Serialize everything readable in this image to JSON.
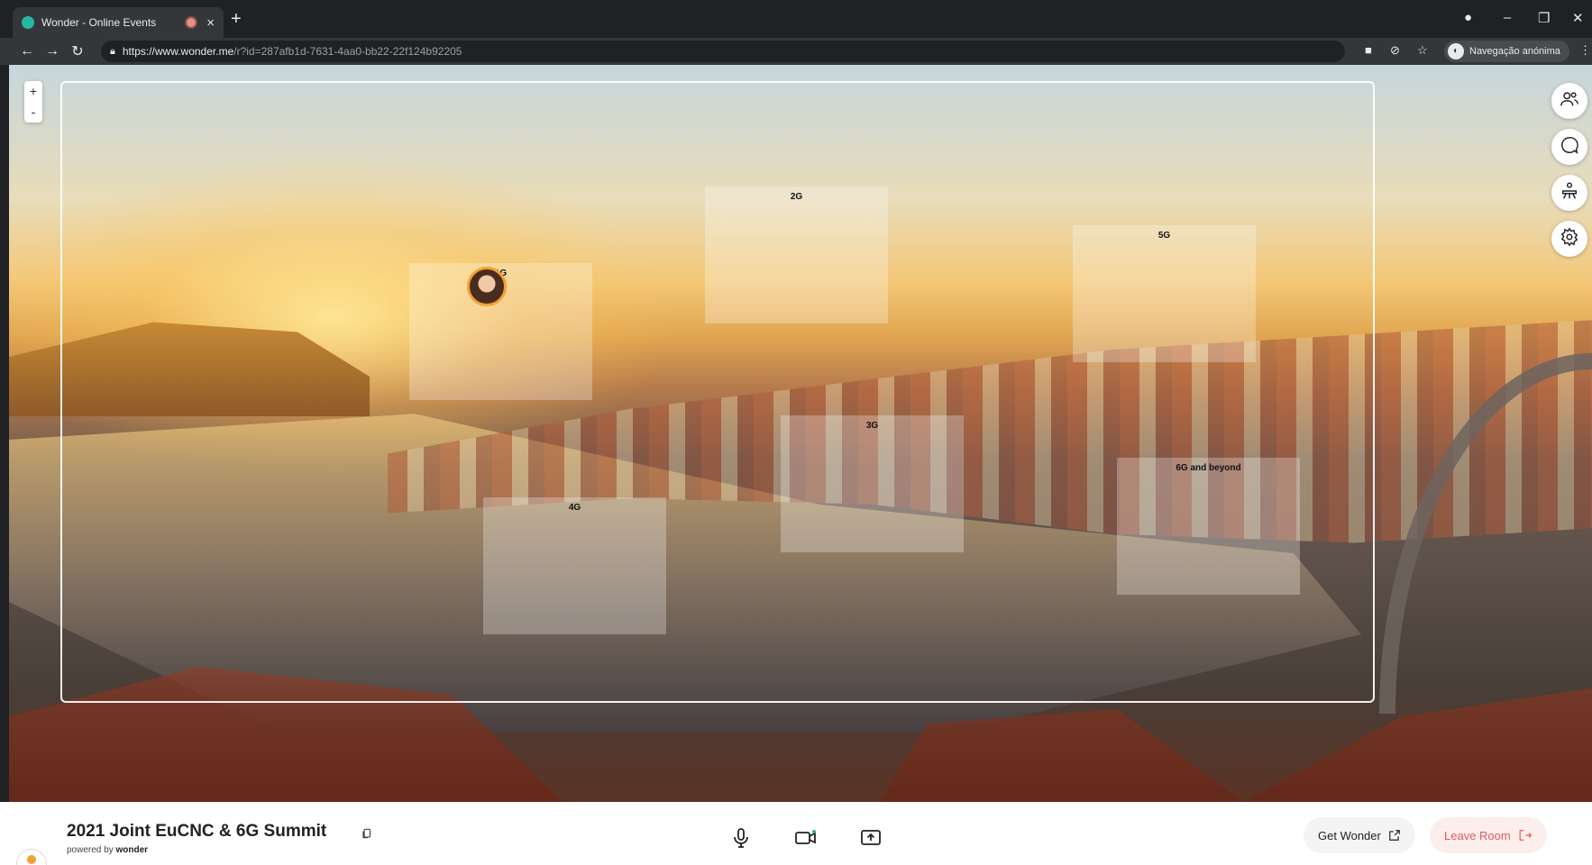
{
  "browser": {
    "tab_title": "Wonder - Online Events",
    "tab_close": "×",
    "new_tab": "+",
    "url_host": "https://www.wonder.me",
    "url_path": "/r?id=287afb1d-7631-4aa0-bb22-22f124b92205",
    "incognito_label": "Navegação anónima",
    "nav_icons": [
      "back-arrow-icon",
      "forward-arrow-icon",
      "reload-icon"
    ],
    "window_controls": [
      "–",
      "❐",
      "✕"
    ]
  },
  "map": {
    "zoom_in": "+",
    "zoom_out": "-",
    "areas": [
      {
        "id": "1g",
        "label": "1G"
      },
      {
        "id": "2g",
        "label": "2G"
      },
      {
        "id": "3g",
        "label": "3G"
      },
      {
        "id": "4g",
        "label": "4G"
      },
      {
        "id": "5g",
        "label": "5G"
      },
      {
        "id": "6g",
        "label": "6G and beyond"
      }
    ],
    "rail_icons": [
      "people-icon",
      "chat-bubble-icon",
      "broadcast-icon",
      "settings-gear-icon"
    ]
  },
  "footer": {
    "room_title": "2021 Joint EuCNC & 6G Summit",
    "powered_prefix": "powered by",
    "powered_brand": "wonder",
    "controls": [
      "microphone-icon",
      "camera-icon",
      "screen-share-icon"
    ],
    "get_wonder": "Get Wonder",
    "leave_room": "Leave Room"
  },
  "colors": {
    "accent_orange": "#f0a233",
    "leave_red": "#e25b5b",
    "browser_dark": "#202124"
  }
}
